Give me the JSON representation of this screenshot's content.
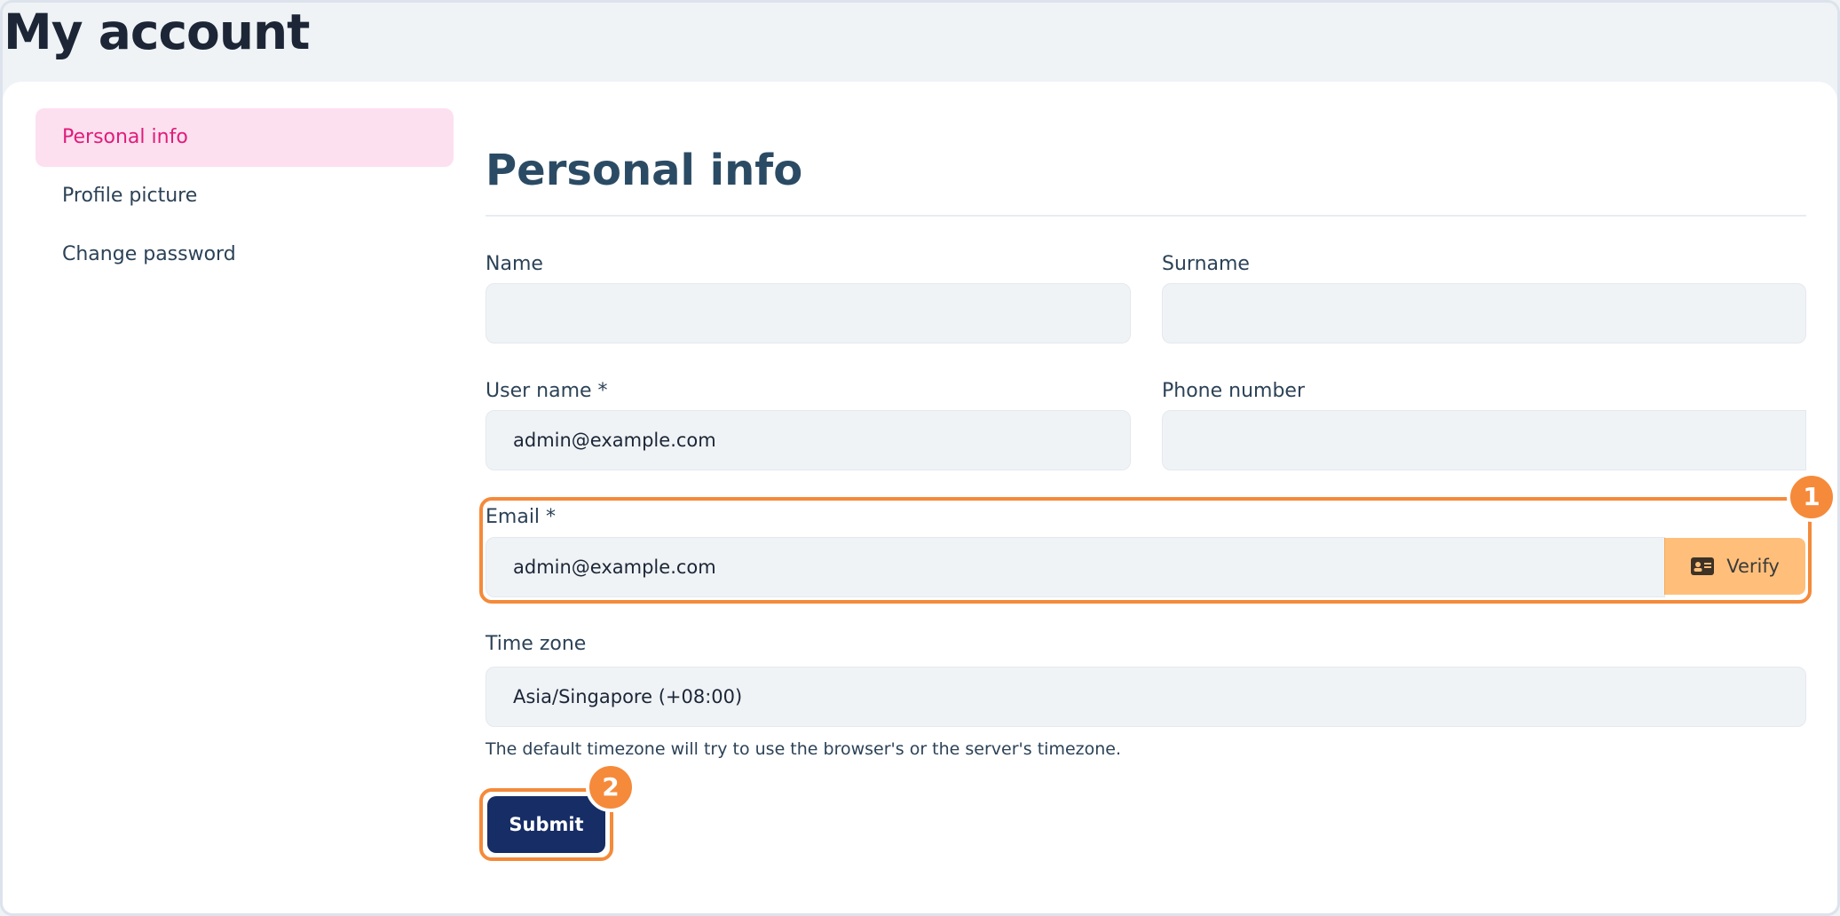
{
  "page": {
    "title": "My account"
  },
  "sidebar": {
    "items": [
      {
        "label": "Personal info",
        "active": true
      },
      {
        "label": "Profile picture",
        "active": false
      },
      {
        "label": "Change password",
        "active": false
      }
    ]
  },
  "form": {
    "section_title": "Personal info",
    "name": {
      "label": "Name",
      "value": ""
    },
    "surname": {
      "label": "Surname",
      "value": ""
    },
    "username": {
      "label": "User name *",
      "value": "admin@example.com"
    },
    "phone": {
      "label": "Phone number",
      "value": ""
    },
    "email": {
      "label": "Email *",
      "value": "admin@example.com",
      "verify_label": "Verify",
      "verify_icon": "id-card-icon"
    },
    "timezone": {
      "label": "Time zone",
      "value": "Asia/Singapore (+08:00)",
      "hint": "The default timezone will try to use the browser's or the server's timezone."
    },
    "submit_label": "Submit"
  },
  "annotations": [
    {
      "number": "1"
    },
    {
      "number": "2"
    }
  ],
  "colors": {
    "accent_pink": "#e01c7b",
    "active_bg": "#fde0ef",
    "submit_bg": "#172d66",
    "verify_bg": "#ffbf7a",
    "highlight": "#f58a3a"
  }
}
